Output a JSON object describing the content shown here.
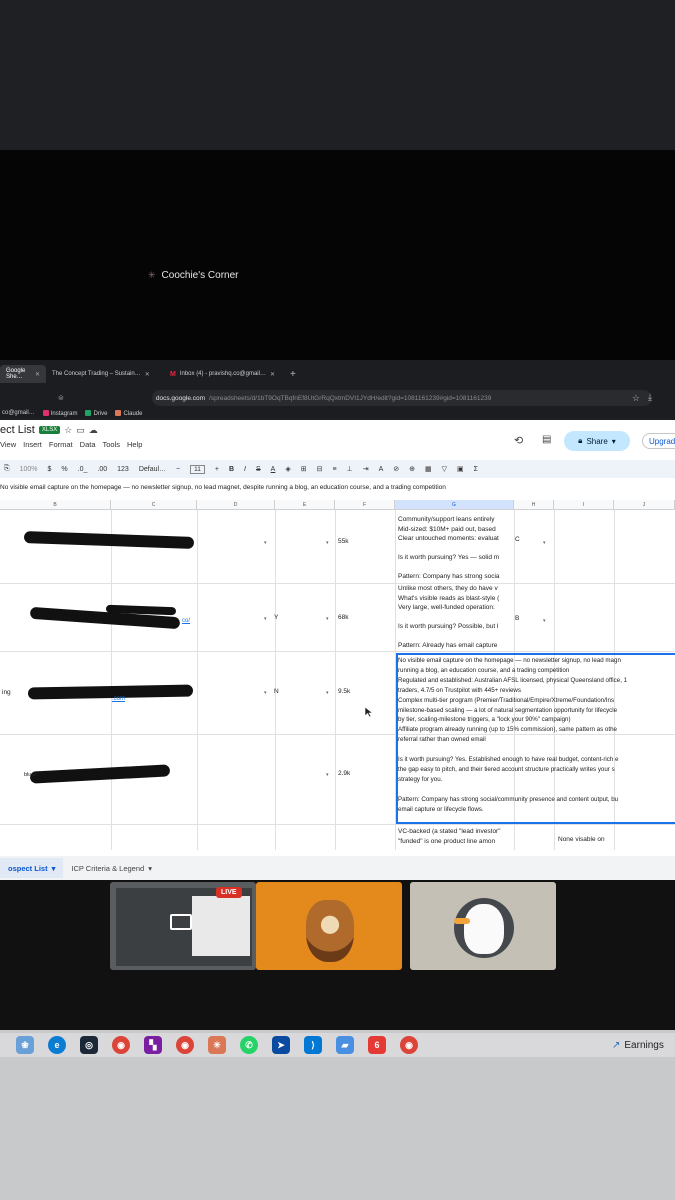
{
  "meeting": {
    "title": "Coochie's Corner"
  },
  "browser": {
    "tabs": [
      {
        "label": "Google She…",
        "active": true
      },
      {
        "label": "The Concept Trading – Sustain…",
        "active": false
      },
      {
        "label": "Inbox (4) - pravishq.co@gmail…",
        "active": false,
        "icon": "gmail-icon"
      }
    ],
    "address_prefix": "docs.google.com",
    "address_rest": "/spreadsheets/d/1bT9OqTBqfnEf8UtGrRqQxtmDVI1JYdH/edit?gid=1081161239#gid=1081161239",
    "bookmarks": [
      "co@gmail…",
      "Instagram",
      "Drive",
      "Claude"
    ]
  },
  "sheet": {
    "doc_title": "ect List",
    "badge": "XLSX",
    "menu": [
      "View",
      "Insert",
      "Format",
      "Data",
      "Tools",
      "Help"
    ],
    "share_label": "Share",
    "upgrade_label": "Upgrad",
    "toolbar": {
      "zoom": "100%",
      "currency": "$",
      "percent": "%",
      "dec_less": ".0_",
      "dec_more": ".00",
      "num_fmt": "123",
      "font": "Defaul…",
      "font_size": "11"
    },
    "formula_text": "No visible email capture on the homepage — no newsletter signup, no lead magnet, despite running a blog, an education course, and a trading competition",
    "columns": [
      "B",
      "C",
      "D",
      "E",
      "F",
      "G",
      "H",
      "I",
      "J"
    ],
    "rows": [
      {
        "e": "",
        "f": "55k",
        "h": "C"
      },
      {
        "d": "Y",
        "f": "68k",
        "h": "B"
      },
      {
        "a": "ing",
        "d": "N",
        "f": "9.5k"
      },
      {
        "b": "blusk",
        "f": "2.9k"
      }
    ],
    "g_row1": [
      "Community/support leans entirely",
      "Mid-sized: $10M+ paid out, based",
      "Clear untouched moments: evaluat",
      "",
      "Is it worth pursuing? Yes — solid m",
      "",
      "Pattern: Company has strong socia"
    ],
    "g_row2": [
      "Unlike most others, they do have v",
      "What's visible reads as blast-style (",
      "Very large, well-funded operation:",
      "",
      "Is it worth pursuing? Possible, but l",
      "",
      "Pattern: Already has email capture"
    ],
    "g_row3": [
      "No visible email capture on the homepage — no newsletter signup, no lead magn",
      "running a blog, an education course, and a trading competition",
      "Regulated and established: Australian AFSL licensed, physical Queensland office, 1",
      "traders, 4.7/5 on Trustpilot with 445+ reviews",
      "Complex multi-tier program (Premier/Traditional/Empire/Xtreme/Foundation/Ins",
      "milestone-based scaling — a lot of natural segmentation opportunity for lifecycle",
      "by tier, scaling-milestone triggers, a \"lock your 90%\" campaign)",
      "Affiliate program already running (up to 15% commission), same pattern as othe",
      "referral rather than owned email",
      "",
      "Is it worth pursuing? Yes. Established enough to have real budget, content-rich e",
      "the gap easy to pitch, and their tiered account structure practically writes your s",
      "strategy for you.",
      "",
      "Pattern: Company has strong social/community presence and content output, bu",
      "email capture or lifecycle flows."
    ],
    "g_row4": [
      "VC-backed (a stated \"lead investor\"",
      "\"funded\" is one product line amon"
    ],
    "i_row4": "None visable on",
    "sheet_tabs": [
      "ospect List",
      "ICP Criteria & Legend"
    ]
  },
  "video": {
    "live_label": "LIVE"
  },
  "taskbar": {
    "news": "Earnings"
  }
}
